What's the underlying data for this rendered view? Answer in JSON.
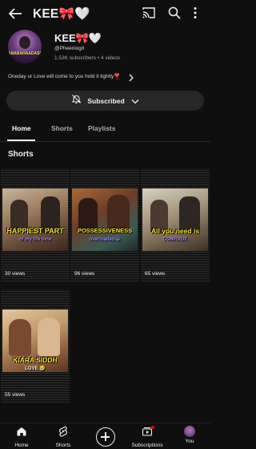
{
  "header": {
    "title": "KEE🎀🤍",
    "icons": [
      "back-arrow-icon",
      "cast-icon",
      "search-icon",
      "more-vert-icon"
    ]
  },
  "channel": {
    "avatar_caption": "ANABAHAADASHOTZ",
    "name": "KEE🎀🤍",
    "handle": "@Pheenixgrl",
    "stats": "1.53K subscribers • 4 videos",
    "description": "Oneday ur Love will come to you hold it tightly❣️"
  },
  "subscribe": {
    "label": "Subscribed"
  },
  "tabs": [
    {
      "label": "Home",
      "active": true
    },
    {
      "label": "Shorts",
      "active": false
    },
    {
      "label": "Playlists",
      "active": false
    }
  ],
  "shorts_section": {
    "title": "Shorts",
    "items": [
      {
        "caption_top": "HAPPIEST PART",
        "caption_bottom": "of my life time",
        "views": "30 views"
      },
      {
        "caption_top": "POSSESSIVENESS",
        "caption_bottom": "overloaded😂",
        "views": "96 views"
      },
      {
        "caption_top": "All you need is",
        "caption_bottom": "COMRADE",
        "views": "65 views"
      },
      {
        "caption_top": "KIARA SIDDH",
        "caption_bottom": "LOVE 🥹",
        "views": "55 views"
      }
    ]
  },
  "bottom_nav": [
    {
      "label": "Home",
      "icon": "home-icon"
    },
    {
      "label": "Shorts",
      "icon": "shorts-icon"
    },
    {
      "label": "",
      "icon": "create-plus-icon"
    },
    {
      "label": "Subscriptions",
      "icon": "subscriptions-icon"
    },
    {
      "label": "You",
      "icon": "you-avatar-icon"
    }
  ],
  "colors": {
    "background": "#0f0f0f",
    "caption_yellow": "#f5e23a",
    "caption_purple": "#9a7cf0",
    "text": "#f1f1f1"
  }
}
